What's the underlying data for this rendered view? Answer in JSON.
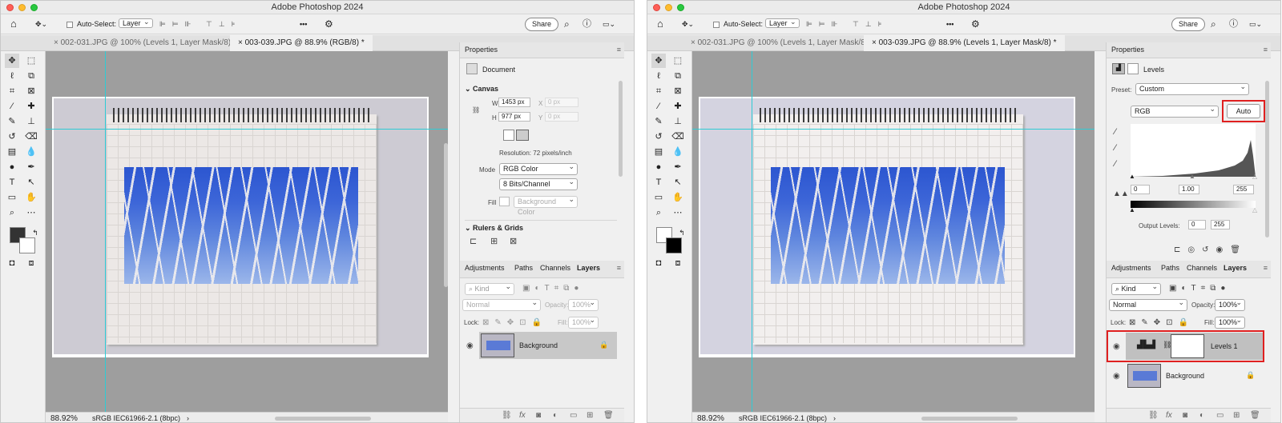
{
  "app_title": "Adobe Photoshop 2024",
  "options": {
    "auto_select_label": "Auto-Select:",
    "auto_select_value": "Layer",
    "share_label": "Share"
  },
  "tabs": [
    "002-031.JPG @ 100% (Levels 1, Layer Mask/8) *",
    "003-039.JPG @ 88.9% (RGB/8) *",
    "003-039.JPG @ 88.9% (Levels 1, Layer Mask/8) *"
  ],
  "status": {
    "zoom": "88.92%",
    "profile": "sRGB IEC61966-2.1 (8bpc)"
  },
  "left_props": {
    "title": "Properties",
    "doc_label": "Document",
    "canvas_header": "Canvas",
    "w_label": "W",
    "w_value": "1453 px",
    "h_label": "H",
    "h_value": "977 px",
    "x_label": "X",
    "x_value": "0 px",
    "y_label": "Y",
    "y_value": "0 px",
    "resolution": "Resolution: 72 pixels/inch",
    "mode_label": "Mode",
    "mode_value": "RGB Color",
    "bits_value": "8 Bits/Channel",
    "fill_label": "Fill",
    "fill_value": "Background Color",
    "rulers_header": "Rulers & Grids"
  },
  "layers_panel": {
    "tabs": [
      "Adjustments",
      "Paths",
      "Channels",
      "Layers"
    ],
    "kind": "Kind",
    "blend": "Normal",
    "opacity_label": "Opacity:",
    "opacity_value": "100%",
    "lock_label": "Lock:",
    "fill_label": "Fill:",
    "fill_value": "100%",
    "background_layer": "Background",
    "levels_layer": "Levels 1"
  },
  "right_props": {
    "title": "Properties",
    "levels_label": "Levels",
    "preset_label": "Preset:",
    "preset_value": "Custom",
    "channel_value": "RGB",
    "auto_label": "Auto",
    "input_black": "0",
    "input_mid": "1.00",
    "input_white": "255",
    "output_label": "Output Levels:",
    "output_black": "0",
    "output_white": "255"
  }
}
